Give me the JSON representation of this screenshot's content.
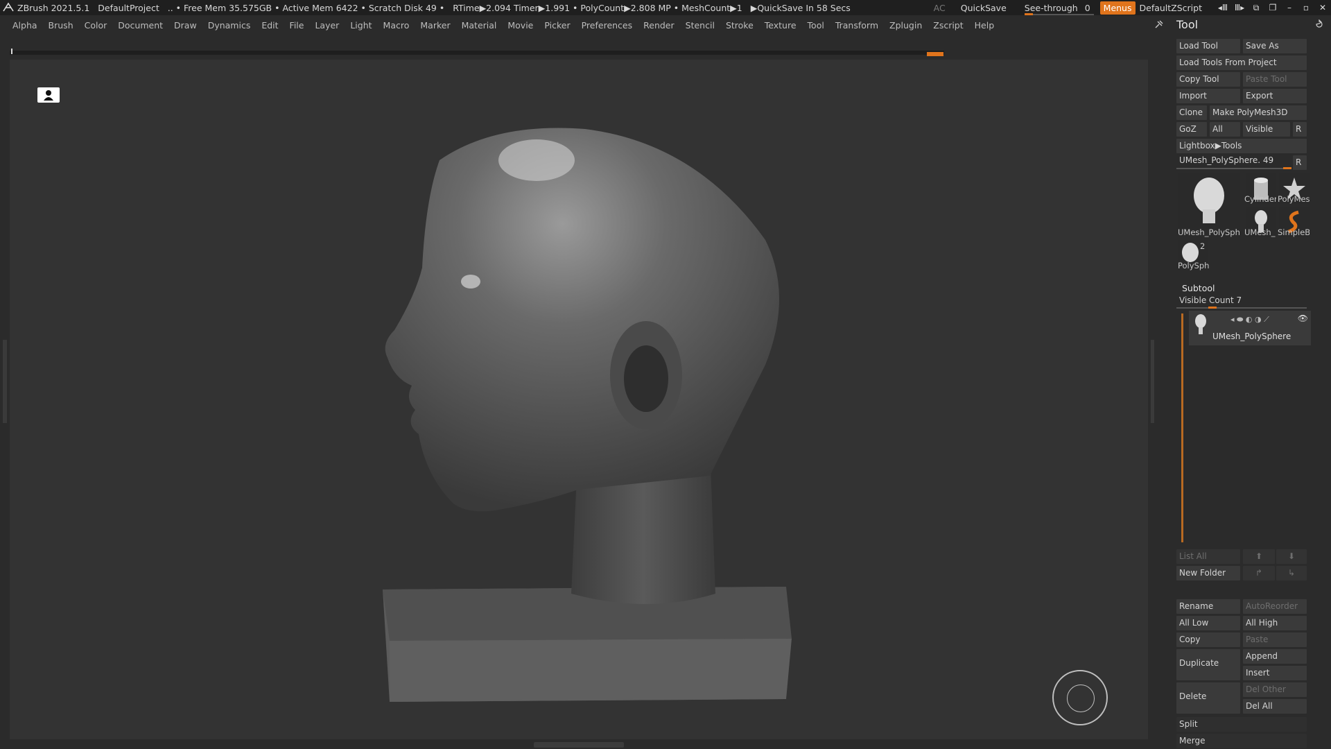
{
  "statusbar": {
    "app": "ZBrush 2021.5.1",
    "project": "DefaultProject",
    "stats": ".. • Free Mem 35.575GB • Active Mem 6422 • Scratch Disk 49 •",
    "timers": "RTime▶2.094 Timer▶1.991 • PolyCount▶2.808 MP • MeshCount▶1",
    "quicksave_timer": "▶QuickSave In 58 Secs",
    "ac": "AC",
    "quicksave": "QuickSave",
    "see_through": "See-through",
    "see_through_value": "0",
    "menus": "Menus",
    "script": "DefaultZScript"
  },
  "menubar": [
    "Alpha",
    "Brush",
    "Color",
    "Document",
    "Draw",
    "Dynamics",
    "Edit",
    "File",
    "Layer",
    "Light",
    "Macro",
    "Marker",
    "Material",
    "Movie",
    "Picker",
    "Preferences",
    "Render",
    "Stencil",
    "Stroke",
    "Texture",
    "Tool",
    "Transform",
    "Zplugin",
    "Zscript",
    "Help"
  ],
  "toolpanel": {
    "title": "Tool",
    "load_tool": "Load Tool",
    "save_as": "Save As",
    "load_from_project": "Load Tools From Project",
    "copy_tool": "Copy Tool",
    "paste_tool": "Paste Tool",
    "import": "Import",
    "export": "Export",
    "clone": "Clone",
    "make_polymesh": "Make PolyMesh3D",
    "goz": "GoZ",
    "all": "All",
    "visible": "Visible",
    "r": "R",
    "lightbox_tools": "Lightbox▶Tools",
    "current_tool": "UMesh_PolySphere. 49",
    "thumbs": [
      "UMesh_PolySphe",
      "Cylinder",
      "PolyMes",
      "UMesh_",
      "SimpleB",
      "PolySph"
    ],
    "thumb_count": "2"
  },
  "subtool": {
    "title": "Subtool",
    "visible_count": "Visible Count 7",
    "item_name": "UMesh_PolySphere",
    "list_all": "List All",
    "new_folder": "New Folder",
    "rename": "Rename",
    "auto_reorder": "AutoReorder",
    "all_low": "All Low",
    "all_high": "All High",
    "copy": "Copy",
    "paste": "Paste",
    "duplicate": "Duplicate",
    "append": "Append",
    "insert": "Insert",
    "delete": "Delete",
    "del_other": "Del Other",
    "del_all": "Del All",
    "split": "Split",
    "merge": "Merge"
  },
  "colors": {
    "accent": "#e0741c",
    "panel": "#2b2b2b",
    "viewport": "#333333"
  },
  "ui_levels": {
    "see_through_fill": 0.0,
    "subtool_visible_fill": 0.12
  }
}
